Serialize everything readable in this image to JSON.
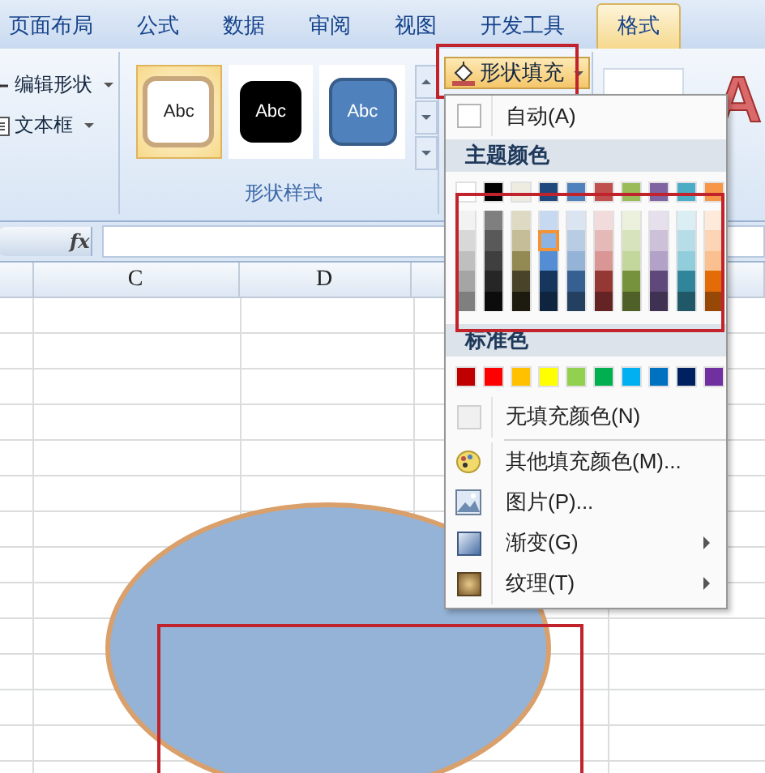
{
  "tabs": [
    {
      "label": "页面布局",
      "selected": false
    },
    {
      "label": "公式",
      "selected": false
    },
    {
      "label": "数据",
      "selected": false
    },
    {
      "label": "审阅",
      "selected": false
    },
    {
      "label": "视图",
      "selected": false
    },
    {
      "label": "开发工具",
      "selected": false
    },
    {
      "label": "格式",
      "selected": true
    }
  ],
  "ribbon": {
    "shape_tools": [
      {
        "label": "编辑形状",
        "kind": "edit"
      },
      {
        "label": "文本框",
        "kind": "textbox"
      }
    ],
    "shape_styles": {
      "label": "形状样式",
      "styles": [
        {
          "text": "Abc",
          "kind": "outline",
          "selected": true
        },
        {
          "text": "Abc",
          "kind": "dark",
          "selected": false
        },
        {
          "text": "Abc",
          "kind": "blue",
          "selected": false
        }
      ]
    },
    "fill_button": {
      "label": "形状填充",
      "pressed": true
    },
    "wordart_preview": "A"
  },
  "formula_bar": {
    "function_label": "fx"
  },
  "sheet": {
    "columns": [
      {
        "label": "C"
      },
      {
        "label": "D"
      }
    ]
  },
  "fill_menu": {
    "auto": {
      "label": "自动(A)"
    },
    "theme_header": "主题颜色",
    "theme_colors": [
      [
        {
          "color": "#ffffff",
          "selected": false
        },
        {
          "color": "#000000",
          "selected": false
        },
        {
          "color": "#eeece1",
          "selected": false
        },
        {
          "color": "#1f497d",
          "selected": false
        },
        {
          "color": "#4f81bd",
          "selected": false
        },
        {
          "color": "#c0504d",
          "selected": false
        },
        {
          "color": "#9bbb59",
          "selected": false
        },
        {
          "color": "#8064a2",
          "selected": false
        },
        {
          "color": "#4bacc6",
          "selected": false
        },
        {
          "color": "#f79646",
          "selected": false
        }
      ],
      [
        {
          "color": "#f2f2f2",
          "selected": false
        },
        {
          "color": "#7f7f7f",
          "selected": false
        },
        {
          "color": "#ddd9c3",
          "selected": false
        },
        {
          "color": "#c6d9f0",
          "selected": false
        },
        {
          "color": "#dbe5f1",
          "selected": false
        },
        {
          "color": "#f2dcdb",
          "selected": false
        },
        {
          "color": "#ebf1dd",
          "selected": false
        },
        {
          "color": "#e5e0ec",
          "selected": false
        },
        {
          "color": "#dbeef3",
          "selected": false
        },
        {
          "color": "#fdeada",
          "selected": false
        }
      ],
      [
        {
          "color": "#d8d8d8",
          "selected": false
        },
        {
          "color": "#595959",
          "selected": false
        },
        {
          "color": "#c4bd97",
          "selected": false
        },
        {
          "color": "#8db3e2",
          "selected": true
        },
        {
          "color": "#b8cce4",
          "selected": false
        },
        {
          "color": "#e5b9b7",
          "selected": false
        },
        {
          "color": "#d7e3bc",
          "selected": false
        },
        {
          "color": "#ccc1d9",
          "selected": false
        },
        {
          "color": "#b7dde8",
          "selected": false
        },
        {
          "color": "#fbd5b5",
          "selected": false
        }
      ],
      [
        {
          "color": "#bfbfbf",
          "selected": false
        },
        {
          "color": "#3f3f3f",
          "selected": false
        },
        {
          "color": "#938953",
          "selected": false
        },
        {
          "color": "#548dd4",
          "selected": false
        },
        {
          "color": "#95b3d7",
          "selected": false
        },
        {
          "color": "#d99694",
          "selected": false
        },
        {
          "color": "#c3d69b",
          "selected": false
        },
        {
          "color": "#b2a2c7",
          "selected": false
        },
        {
          "color": "#92cddc",
          "selected": false
        },
        {
          "color": "#fac08f",
          "selected": false
        }
      ],
      [
        {
          "color": "#a5a5a5",
          "selected": false
        },
        {
          "color": "#262626",
          "selected": false
        },
        {
          "color": "#494429",
          "selected": false
        },
        {
          "color": "#17365d",
          "selected": false
        },
        {
          "color": "#366092",
          "selected": false
        },
        {
          "color": "#953734",
          "selected": false
        },
        {
          "color": "#76923c",
          "selected": false
        },
        {
          "color": "#5f497a",
          "selected": false
        },
        {
          "color": "#31859b",
          "selected": false
        },
        {
          "color": "#e36c09",
          "selected": false
        }
      ],
      [
        {
          "color": "#7f7f7f",
          "selected": false
        },
        {
          "color": "#0c0c0c",
          "selected": false
        },
        {
          "color": "#1d1b10",
          "selected": false
        },
        {
          "color": "#0f243e",
          "selected": false
        },
        {
          "color": "#244061",
          "selected": false
        },
        {
          "color": "#632423",
          "selected": false
        },
        {
          "color": "#4f6128",
          "selected": false
        },
        {
          "color": "#3f3151",
          "selected": false
        },
        {
          "color": "#205867",
          "selected": false
        },
        {
          "color": "#974806",
          "selected": false
        }
      ]
    ],
    "standard_header": "标准色",
    "standard_colors": [
      {
        "color": "#c00000",
        "selected": false
      },
      {
        "color": "#ff0000",
        "selected": false
      },
      {
        "color": "#ffc000",
        "selected": false
      },
      {
        "color": "#ffff00",
        "selected": false
      },
      {
        "color": "#92d050",
        "selected": false
      },
      {
        "color": "#00b050",
        "selected": false
      },
      {
        "color": "#00b0f0",
        "selected": false
      },
      {
        "color": "#0070c0",
        "selected": false
      },
      {
        "color": "#002060",
        "selected": false
      },
      {
        "color": "#7030a0",
        "selected": false
      }
    ],
    "items": [
      {
        "kind": "none",
        "label": "无填充颜色(N)",
        "has_submenu": false
      },
      {
        "kind": "more",
        "label": "其他填充颜色(M)...",
        "has_submenu": false
      },
      {
        "kind": "picture",
        "label": "图片(P)...",
        "has_submenu": false
      },
      {
        "kind": "gradient",
        "label": "渐变(G)",
        "has_submenu": true
      },
      {
        "kind": "texture",
        "label": "纹理(T)",
        "has_submenu": true
      }
    ]
  }
}
